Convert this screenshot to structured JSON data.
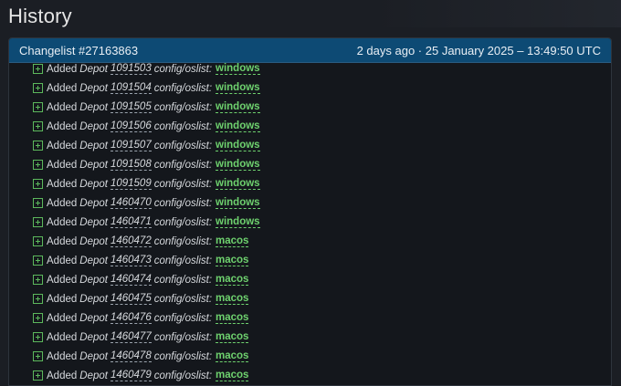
{
  "page": {
    "title": "History"
  },
  "changelist": {
    "title": "Changelist #27163863",
    "date": "2 days ago · 25 January 2025 – 13:49:50 UTC"
  },
  "entries": [
    {
      "verb": "Added",
      "depot_word": "Depot",
      "depot_id": "1091503",
      "path": "config/oslist:",
      "value": "windows"
    },
    {
      "verb": "Added",
      "depot_word": "Depot",
      "depot_id": "1091504",
      "path": "config/oslist:",
      "value": "windows"
    },
    {
      "verb": "Added",
      "depot_word": "Depot",
      "depot_id": "1091505",
      "path": "config/oslist:",
      "value": "windows"
    },
    {
      "verb": "Added",
      "depot_word": "Depot",
      "depot_id": "1091506",
      "path": "config/oslist:",
      "value": "windows"
    },
    {
      "verb": "Added",
      "depot_word": "Depot",
      "depot_id": "1091507",
      "path": "config/oslist:",
      "value": "windows"
    },
    {
      "verb": "Added",
      "depot_word": "Depot",
      "depot_id": "1091508",
      "path": "config/oslist:",
      "value": "windows"
    },
    {
      "verb": "Added",
      "depot_word": "Depot",
      "depot_id": "1091509",
      "path": "config/oslist:",
      "value": "windows"
    },
    {
      "verb": "Added",
      "depot_word": "Depot",
      "depot_id": "1460470",
      "path": "config/oslist:",
      "value": "windows"
    },
    {
      "verb": "Added",
      "depot_word": "Depot",
      "depot_id": "1460471",
      "path": "config/oslist:",
      "value": "windows"
    },
    {
      "verb": "Added",
      "depot_word": "Depot",
      "depot_id": "1460472",
      "path": "config/oslist:",
      "value": "macos"
    },
    {
      "verb": "Added",
      "depot_word": "Depot",
      "depot_id": "1460473",
      "path": "config/oslist:",
      "value": "macos"
    },
    {
      "verb": "Added",
      "depot_word": "Depot",
      "depot_id": "1460474",
      "path": "config/oslist:",
      "value": "macos"
    },
    {
      "verb": "Added",
      "depot_word": "Depot",
      "depot_id": "1460475",
      "path": "config/oslist:",
      "value": "macos"
    },
    {
      "verb": "Added",
      "depot_word": "Depot",
      "depot_id": "1460476",
      "path": "config/oslist:",
      "value": "macos"
    },
    {
      "verb": "Added",
      "depot_word": "Depot",
      "depot_id": "1460477",
      "path": "config/oslist:",
      "value": "macos"
    },
    {
      "verb": "Added",
      "depot_word": "Depot",
      "depot_id": "1460478",
      "path": "config/oslist:",
      "value": "macos"
    },
    {
      "verb": "Added",
      "depot_word": "Depot",
      "depot_id": "1460479",
      "path": "config/oslist:",
      "value": "macos"
    }
  ],
  "colors": {
    "background": "#1b1e24",
    "panel_header": "#0d4a74",
    "added_green": "#5cb85c",
    "link_green": "#6ed16e"
  },
  "icons": {
    "entry_icon": "plus-square-icon"
  }
}
